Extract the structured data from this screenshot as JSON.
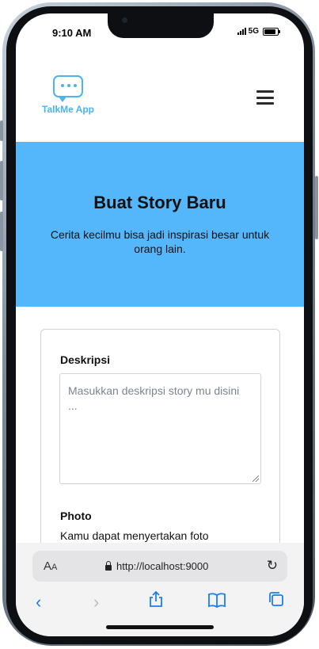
{
  "status_bar": {
    "time": "9:10 AM",
    "network": "5G"
  },
  "app": {
    "name": "TalkMe App",
    "logo_icon": "chat-bubble-icon",
    "menu_icon": "hamburger-icon"
  },
  "hero": {
    "title": "Buat Story Baru",
    "subtitle": "Cerita kecilmu bisa jadi inspirasi besar untuk orang lain.",
    "background": "#54b7fb"
  },
  "form": {
    "description_label": "Deskripsi",
    "description_placeholder": "Masukkan deskripsi story mu disini ...",
    "description_value": "",
    "photo_label": "Photo",
    "photo_helper": "Kamu dapat menyertakan foto"
  },
  "browser": {
    "text_size_label": "AA",
    "url": "http://localhost:9000",
    "toolbar": [
      "back-icon",
      "forward-icon",
      "share-icon",
      "bookmarks-icon",
      "tabs-icon"
    ]
  },
  "colors": {
    "accent": "#4db2ee",
    "link": "#1a7cf5"
  }
}
